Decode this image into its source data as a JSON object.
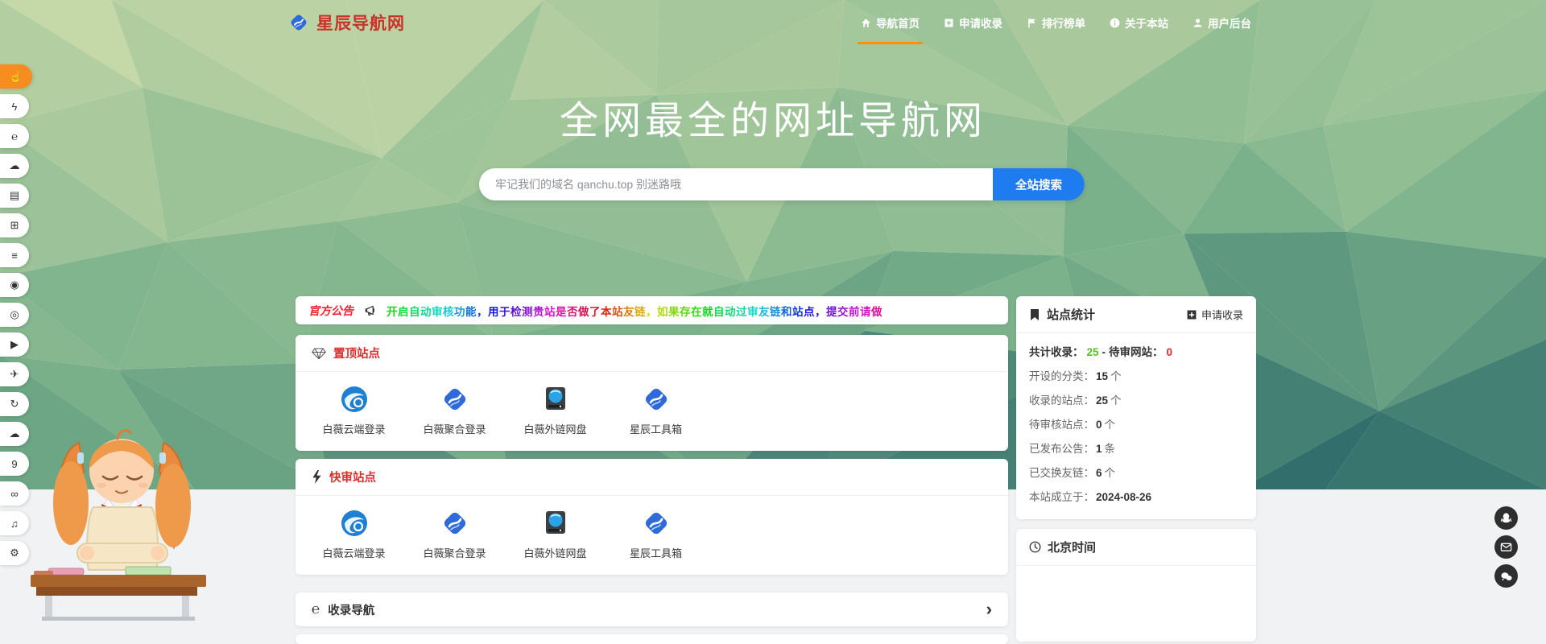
{
  "brand": {
    "name": "星辰导航网"
  },
  "nav": {
    "items": [
      {
        "id": "home",
        "label": "导航首页",
        "icon": "home-icon",
        "active": true
      },
      {
        "id": "apply",
        "label": "申请收录",
        "icon": "plus-square-icon",
        "active": false
      },
      {
        "id": "rank",
        "label": "排行榜单",
        "icon": "flag-icon",
        "active": false
      },
      {
        "id": "about",
        "label": "关于本站",
        "icon": "info-icon",
        "active": false
      },
      {
        "id": "user",
        "label": "用户后台",
        "icon": "user-icon",
        "active": false
      }
    ]
  },
  "hero": {
    "title": "全网最全的网址导航网",
    "search_placeholder": "牢记我们的域名 qanchu.top 别迷路哦",
    "search_button": "全站搜索"
  },
  "announcement": {
    "label": "官方公告",
    "icon": "megaphone-icon",
    "text": "开启自动审核功能，用于检测贵站是否做了本站友链，如果存在就自动过审友链和站点，提交前请做"
  },
  "sections": [
    {
      "title": "置顶站点",
      "icon": "diamond-icon",
      "sites": [
        {
          "name": "白薇云端登录",
          "icon": "cloud-logo"
        },
        {
          "name": "白薇聚合登录",
          "icon": "diamond-logo"
        },
        {
          "name": "白薇外链网盘",
          "icon": "drive-logo"
        },
        {
          "name": "星辰工具箱",
          "icon": "diamond-logo"
        }
      ]
    },
    {
      "title": "快审站点",
      "icon": "lightning-icon",
      "sites": [
        {
          "name": "白薇云端登录",
          "icon": "cloud-logo"
        },
        {
          "name": "白薇聚合登录",
          "icon": "diamond-logo"
        },
        {
          "name": "白薇外链网盘",
          "icon": "drive-logo"
        },
        {
          "name": "星辰工具箱",
          "icon": "diamond-logo"
        }
      ]
    }
  ],
  "catalog": {
    "title": "收录导航",
    "icon": "recycle-icon",
    "glyph": "℮",
    "chevron": "›"
  },
  "stats": {
    "title": "站点统计",
    "icon": "bookmark-icon",
    "apply_label": "申请收录",
    "summary": {
      "label_total": "共计收录：",
      "total": "25",
      "separator": "-",
      "label_pending": "待审网站：",
      "pending": "0"
    },
    "rows": [
      {
        "label": "开设的分类：",
        "value": "15",
        "suffix": "个"
      },
      {
        "label": "收录的站点：",
        "value": "25",
        "suffix": "个"
      },
      {
        "label": "待审核站点：",
        "value": "0",
        "suffix": "个"
      },
      {
        "label": "已发布公告：",
        "value": "1",
        "suffix": "条"
      },
      {
        "label": "已交换友链：",
        "value": "6",
        "suffix": "个"
      },
      {
        "label": "本站成立于：",
        "value": "2024-08-26",
        "suffix": ""
      }
    ]
  },
  "clock_panel": {
    "title": "北京时间",
    "icon": "clock-icon"
  },
  "sidebar": {
    "items": [
      {
        "name": "like-icon",
        "glyph": "☝",
        "active": true
      },
      {
        "name": "lightning-icon",
        "glyph": "ϟ",
        "active": false
      },
      {
        "name": "recycle-icon",
        "glyph": "℮",
        "active": false
      },
      {
        "name": "cloud-icon",
        "glyph": "☁",
        "active": false
      },
      {
        "name": "book-icon",
        "glyph": "▤",
        "active": false
      },
      {
        "name": "cart-icon",
        "glyph": "⊞",
        "active": false
      },
      {
        "name": "list-icon",
        "glyph": "≡",
        "active": false
      },
      {
        "name": "disc-icon",
        "glyph": "◉",
        "active": false
      },
      {
        "name": "target-icon",
        "glyph": "◎",
        "active": false
      },
      {
        "name": "play-icon",
        "glyph": "▶",
        "active": false
      },
      {
        "name": "rocket-icon",
        "glyph": "✈",
        "active": false
      },
      {
        "name": "refresh-icon",
        "glyph": "↻",
        "active": false
      },
      {
        "name": "cloud-dots-icon",
        "glyph": "☁",
        "active": false
      },
      {
        "name": "hook-icon",
        "glyph": "9",
        "active": false
      },
      {
        "name": "infinity-icon",
        "glyph": "∞",
        "active": false
      },
      {
        "name": "music-icon",
        "glyph": "♫",
        "active": false
      },
      {
        "name": "settings-icon",
        "glyph": "⚙",
        "active": false
      }
    ]
  },
  "floats": [
    {
      "name": "qq-icon"
    },
    {
      "name": "mail-icon"
    },
    {
      "name": "wechat-icon"
    }
  ],
  "colors": {
    "accent_orange": "#f78c1f",
    "underline_orange": "#ff9100",
    "brand_red": "#c8342a",
    "section_red": "#e02b2b",
    "link_blue": "#1f7bf0",
    "stat_green": "#52c41a",
    "stat_red": "#f5222d"
  }
}
